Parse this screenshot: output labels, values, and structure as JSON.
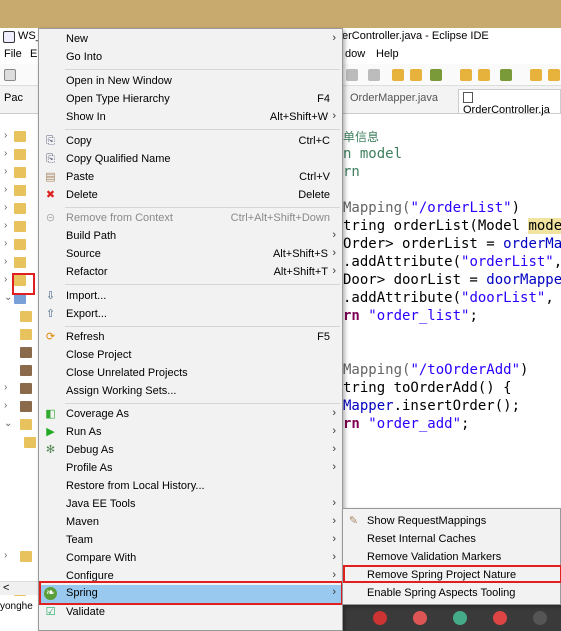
{
  "window": {
    "title_left": "WS_",
    "title_right": "erController.java - Eclipse IDE",
    "menus": {
      "file": "File",
      "edit": "E",
      "window": "dow",
      "help": "Help"
    }
  },
  "editor_tabs": {
    "left_panel": "Pac",
    "tab1": "OrderMapper.java",
    "tab2": "OrderController.ja"
  },
  "status": {
    "user": "yonghe",
    "scroll_left": "<"
  },
  "code": {
    "comment": "单信息",
    "param_line": "n model",
    "ret_line": "rn",
    "l1_ann": "Mapping(",
    "l1_str": "\"/orderList\"",
    "l1_end": ")",
    "l2": "tring orderList(Model ",
    "l2_hl": "model",
    "l2_end": ")",
    "l3_a": "Order> orderList = ",
    "l3_b": "orderMap",
    "l4_a": ".addAttribute(",
    "l4_str": "\"orderList\"",
    "l4_end": ",",
    "l5_a": "Door> doorList = ",
    "l5_b": "doorMapper",
    "l6_a": ".addAttribute(",
    "l6_str": "\"doorList\"",
    "l6_end": ", o",
    "l7_kw": "rn",
    "l7_str": " \"order_list\"",
    "l7_end": ";",
    "l8_ann": "Mapping(",
    "l8_str": "\"/toOrderAdd\"",
    "l8_end": ")",
    "l9": "tring toOrderAdd() {",
    "l10_fld": "Mapper",
    "l10_end": ".insertOrder();",
    "l11_kw": "rn",
    "l11_str": " \"order_add\"",
    "l11_end": ";"
  },
  "context_menu": {
    "new": "New",
    "go_into": "Go Into",
    "open_new_window": "Open in New Window",
    "open_type_hierarchy": "Open Type Hierarchy",
    "open_type_hierarchy_sc": "F4",
    "show_in": "Show In",
    "show_in_sc": "Alt+Shift+W",
    "copy": "Copy",
    "copy_sc": "Ctrl+C",
    "copy_qualified": "Copy Qualified Name",
    "paste": "Paste",
    "paste_sc": "Ctrl+V",
    "delete": "Delete",
    "delete_sc": "Delete",
    "remove_context": "Remove from Context",
    "remove_context_sc": "Ctrl+Alt+Shift+Down",
    "build_path": "Build Path",
    "source": "Source",
    "source_sc": "Alt+Shift+S",
    "refactor": "Refactor",
    "refactor_sc": "Alt+Shift+T",
    "import": "Import...",
    "export": "Export...",
    "refresh": "Refresh",
    "refresh_sc": "F5",
    "close_project": "Close Project",
    "close_unrelated": "Close Unrelated Projects",
    "assign_working_sets": "Assign Working Sets...",
    "coverage_as": "Coverage As",
    "run_as": "Run As",
    "debug_as": "Debug As",
    "profile_as": "Profile As",
    "restore_history": "Restore from Local History...",
    "java_ee_tools": "Java EE Tools",
    "maven": "Maven",
    "team": "Team",
    "compare_with": "Compare With",
    "configure": "Configure",
    "spring": "Spring",
    "validate": "Validate"
  },
  "spring_submenu": {
    "show_request_mappings": "Show RequestMappings",
    "reset_caches": "Reset Internal Caches",
    "remove_validation": "Remove Validation Markers",
    "remove_nature": "Remove Spring Project Nature",
    "enable_aspects": "Enable Spring Aspects Tooling"
  },
  "colors": {
    "highlight": "#99c9ef",
    "annotation_box": "#e02020",
    "banner": "#c8a96e"
  }
}
